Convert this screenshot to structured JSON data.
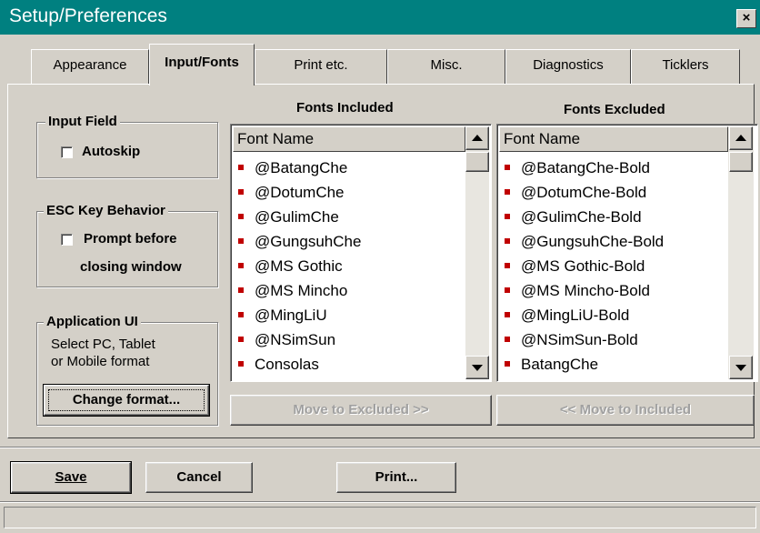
{
  "window": {
    "title": "Setup/Preferences",
    "close_glyph": "×"
  },
  "tabs": [
    {
      "label": "Appearance",
      "active": false
    },
    {
      "label": "Input/Fonts",
      "active": true
    },
    {
      "label": "Print etc.",
      "active": false
    },
    {
      "label": "Misc.",
      "active": false
    },
    {
      "label": "Diagnostics",
      "active": false
    },
    {
      "label": "Ticklers",
      "active": false
    }
  ],
  "input_field": {
    "title": "Input Field",
    "autoskip_label": "Autoskip",
    "autoskip_checked": false
  },
  "esc_key": {
    "title": "ESC Key Behavior",
    "prompt_label_line1": "Prompt before",
    "prompt_label_line2": "closing window",
    "prompt_checked": false
  },
  "application_ui": {
    "title": "Application UI",
    "desc_line1": "Select PC, Tablet",
    "desc_line2": "or Mobile format",
    "change_button": "Change format..."
  },
  "fonts_included": {
    "title": "Fonts Included",
    "column_header": "Font Name",
    "items": [
      "@BatangChe",
      "@DotumChe",
      "@GulimChe",
      "@GungsuhChe",
      "@MS Gothic",
      "@MS Mincho",
      "@MingLiU",
      "@NSimSun",
      "Consolas"
    ],
    "move_button": "Move to Excluded >>"
  },
  "fonts_excluded": {
    "title": "Fonts Excluded",
    "column_header": "Font Name",
    "items": [
      "@BatangChe-Bold",
      "@DotumChe-Bold",
      "@GulimChe-Bold",
      "@GungsuhChe-Bold",
      "@MS Gothic-Bold",
      "@MS Mincho-Bold",
      "@MingLiU-Bold",
      "@NSimSun-Bold",
      "BatangChe"
    ],
    "move_button": "<< Move to Included"
  },
  "footer": {
    "save": "Save",
    "cancel": "Cancel",
    "print": "Print..."
  },
  "colors": {
    "titlebar": "#008080",
    "face": "#d4d0c8",
    "bullet": "#c00000"
  },
  "icons": {
    "close": "close-icon",
    "scroll_up": "arrow-up-icon",
    "scroll_down": "arrow-down-icon",
    "bullet": "bullet-icon"
  }
}
